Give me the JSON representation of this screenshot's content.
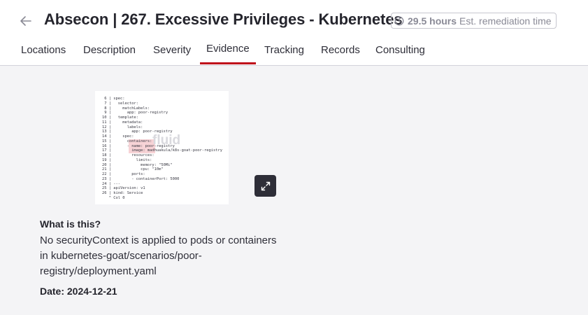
{
  "header": {
    "title": "Absecon | 267. Excessive Privileges - Kubernetes",
    "remediation_hours": "29.5 hours",
    "remediation_label": "Est. remediation time"
  },
  "tabs": [
    {
      "label": "Locations",
      "active": false
    },
    {
      "label": "Description",
      "active": false
    },
    {
      "label": "Severity",
      "active": false
    },
    {
      "label": "Evidence",
      "active": true
    },
    {
      "label": "Tracking",
      "active": false
    },
    {
      "label": "Records",
      "active": false
    },
    {
      "label": "Consulting",
      "active": false
    }
  ],
  "evidence": {
    "image_code": [
      " 6 | spec:",
      " 7 |   selector:",
      " 8 |     matchLabels:",
      " 9 |       app: poor-registry",
      "10 |   template:",
      "11 |     metadata:",
      "12 |       labels:",
      "13 |         app: poor-registry",
      "14 |     spec:",
      "15 |       containers:",
      "16 |       - name: poor-registry",
      "17 |         image: madhuakula/k8s-goat-poor-registry",
      "18 |         resources:",
      "19 |           limits:",
      "20 |             memory: \"50Mi\"",
      "21 |             cpu: \"10m\"",
      "22 |         ports:",
      "23 |         - containerPort: 5000",
      "24 | ---",
      "25 | apiVersion: v1",
      "26 | kind: Service",
      "   ^ Col 0"
    ],
    "watermark": "fluid",
    "question": "What is this?",
    "description": "No securityContext is applied to pods or containers in kubernetes-goat/scenarios/poor-registry/deployment.yaml",
    "date": "Date: 2024-12-21"
  },
  "colors": {
    "accent": "#bf0b1a",
    "expand_button": "#2e2e38",
    "code_highlight": "#f7d3d6"
  },
  "icons": {
    "back": "arrow-left-icon",
    "clock": "clock-icon",
    "expand": "expand-icon"
  }
}
